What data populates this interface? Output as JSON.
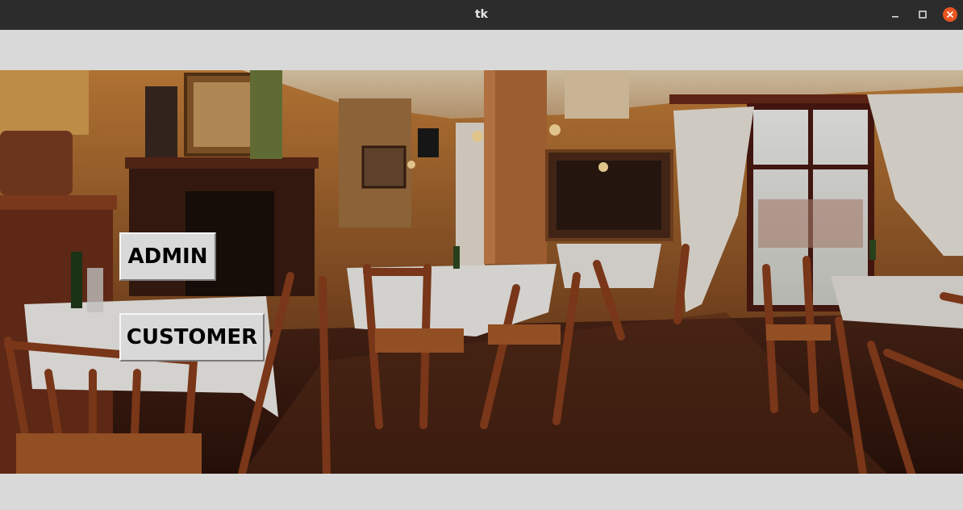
{
  "window": {
    "title": "tk",
    "controls": {
      "minimize": "minimize-icon",
      "maximize": "maximize-icon",
      "close": "close-icon"
    },
    "close_color": "#e95420"
  },
  "background_image": {
    "subject": "restaurant dining room interior"
  },
  "buttons": {
    "admin_label": "ADMIN",
    "customer_label": "CUSTOMER"
  }
}
